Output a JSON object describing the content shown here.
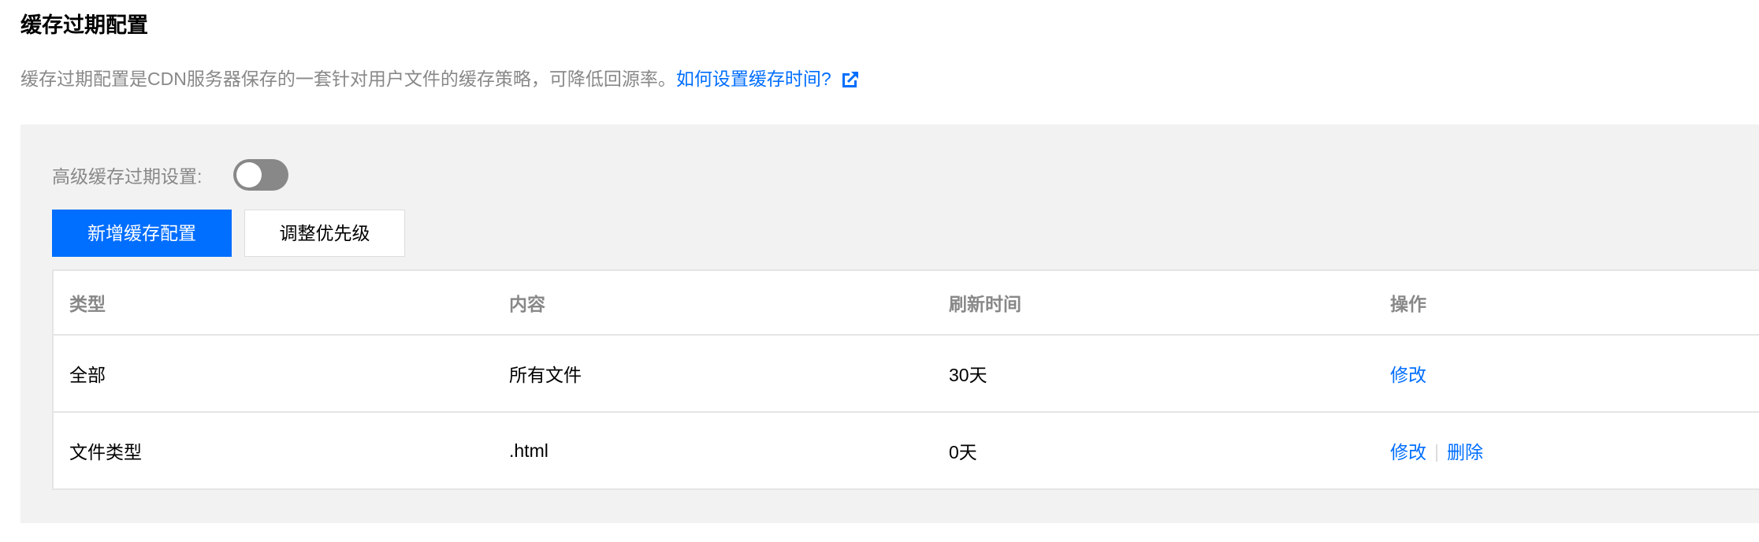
{
  "page": {
    "title": "缓存过期配置",
    "description": "缓存过期配置是CDN服务器保存的一套针对用户文件的缓存策略，可降低回源率。",
    "help_link": "如何设置缓存时间?"
  },
  "advanced": {
    "label": "高级缓存过期设置:",
    "enabled": false
  },
  "toolbar": {
    "add_label": "新增缓存配置",
    "priority_label": "调整优先级"
  },
  "table": {
    "headers": {
      "type": "类型",
      "content": "内容",
      "refresh": "刷新时间",
      "actions": "操作"
    },
    "rows": [
      {
        "type": "全部",
        "content": "所有文件",
        "refresh": "30天",
        "edit": "修改"
      },
      {
        "type": "文件类型",
        "content": ".html",
        "refresh": "0天",
        "edit": "修改",
        "delete": "删除"
      }
    ]
  },
  "colors": {
    "accent": "#006eff",
    "muted_text": "#888888",
    "panel_bg": "#f2f2f2",
    "toggle_off": "#888888"
  },
  "icons": {
    "help_link_icon": "external-link-icon"
  }
}
